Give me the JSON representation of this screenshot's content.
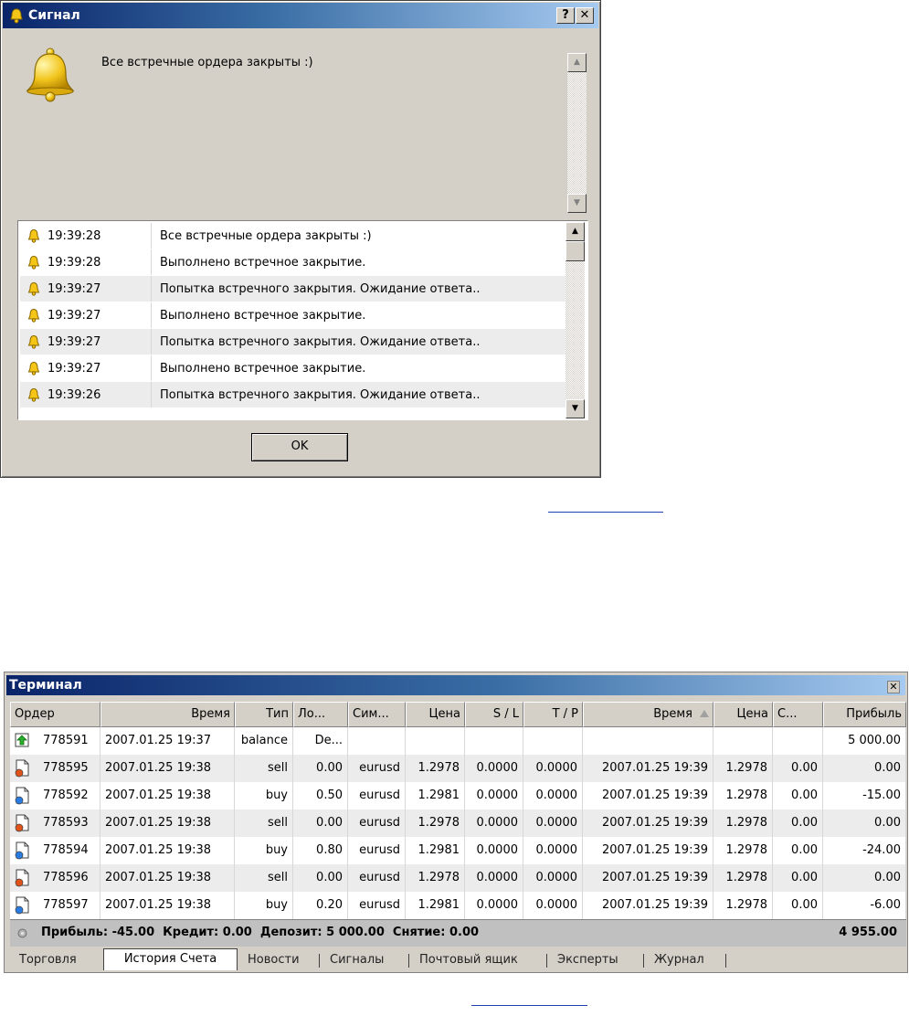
{
  "signal_dialog": {
    "title": "Сигнал",
    "help_label": "?",
    "close_label": "✕",
    "message": "Все встречные ордера закрыты :)",
    "log": [
      {
        "time": "19:39:28",
        "text": "Все встречные ордера закрыты :)"
      },
      {
        "time": "19:39:28",
        "text": "Выполнено встречное закрытие."
      },
      {
        "time": "19:39:27",
        "text": "Попытка встречного закрытия. Ожидание ответа.."
      },
      {
        "time": "19:39:27",
        "text": "Выполнено встречное закрытие."
      },
      {
        "time": "19:39:27",
        "text": "Попытка встречного закрытия. Ожидание ответа.."
      },
      {
        "time": "19:39:27",
        "text": "Выполнено встречное закрытие."
      },
      {
        "time": "19:39:26",
        "text": "Попытка встречного закрытия. Ожидание ответа.."
      }
    ],
    "ok_label": "OK"
  },
  "terminal": {
    "title": "Терминал",
    "close_label": "✕",
    "columns": [
      "Ордер",
      "Время",
      "Тип",
      "Ло...",
      "Сим...",
      "Цена",
      "S / L",
      "T / P",
      "Время",
      "Цена",
      "С...",
      "Прибыль"
    ],
    "rows": [
      {
        "icon": "balance",
        "order": "778591",
        "open_time": "2007.01.25 19:37",
        "type": "balance",
        "lots": "De...",
        "symbol": "",
        "price": "",
        "sl": "",
        "tp": "",
        "close_time": "",
        "close_price": "",
        "swap": "",
        "profit": "5 000.00"
      },
      {
        "icon": "sell",
        "order": "778595",
        "open_time": "2007.01.25 19:38",
        "type": "sell",
        "lots": "0.00",
        "symbol": "eurusd",
        "price": "1.2978",
        "sl": "0.0000",
        "tp": "0.0000",
        "close_time": "2007.01.25 19:39",
        "close_price": "1.2978",
        "swap": "0.00",
        "profit": "0.00"
      },
      {
        "icon": "buy",
        "order": "778592",
        "open_time": "2007.01.25 19:38",
        "type": "buy",
        "lots": "0.50",
        "symbol": "eurusd",
        "price": "1.2981",
        "sl": "0.0000",
        "tp": "0.0000",
        "close_time": "2007.01.25 19:39",
        "close_price": "1.2978",
        "swap": "0.00",
        "profit": "-15.00"
      },
      {
        "icon": "sell",
        "order": "778593",
        "open_time": "2007.01.25 19:38",
        "type": "sell",
        "lots": "0.00",
        "symbol": "eurusd",
        "price": "1.2978",
        "sl": "0.0000",
        "tp": "0.0000",
        "close_time": "2007.01.25 19:39",
        "close_price": "1.2978",
        "swap": "0.00",
        "profit": "0.00"
      },
      {
        "icon": "buy",
        "order": "778594",
        "open_time": "2007.01.25 19:38",
        "type": "buy",
        "lots": "0.80",
        "symbol": "eurusd",
        "price": "1.2981",
        "sl": "0.0000",
        "tp": "0.0000",
        "close_time": "2007.01.25 19:39",
        "close_price": "1.2978",
        "swap": "0.00",
        "profit": "-24.00"
      },
      {
        "icon": "sell",
        "order": "778596",
        "open_time": "2007.01.25 19:38",
        "type": "sell",
        "lots": "0.00",
        "symbol": "eurusd",
        "price": "1.2978",
        "sl": "0.0000",
        "tp": "0.0000",
        "close_time": "2007.01.25 19:39",
        "close_price": "1.2978",
        "swap": "0.00",
        "profit": "0.00"
      },
      {
        "icon": "buy",
        "order": "778597",
        "open_time": "2007.01.25 19:38",
        "type": "buy",
        "lots": "0.20",
        "symbol": "eurusd",
        "price": "1.2981",
        "sl": "0.0000",
        "tp": "0.0000",
        "close_time": "2007.01.25 19:39",
        "close_price": "1.2978",
        "swap": "0.00",
        "profit": "-6.00"
      }
    ],
    "summary": {
      "text": "Прибыль: -45.00  Кредит: 0.00  Депозит: 5 000.00  Снятие: 0.00",
      "total": "4 955.00"
    },
    "tabs": [
      "Торговля",
      "История Счета",
      "Новости",
      "Сигналы",
      "Почтовый ящик",
      "Эксперты",
      "Журнал"
    ],
    "active_tab": "История Счета"
  },
  "colors": {
    "title_bar": "#0a246a",
    "window_face": "#d4d0c8",
    "bell": "#f0c020",
    "link_underline": "#1f3fae"
  }
}
